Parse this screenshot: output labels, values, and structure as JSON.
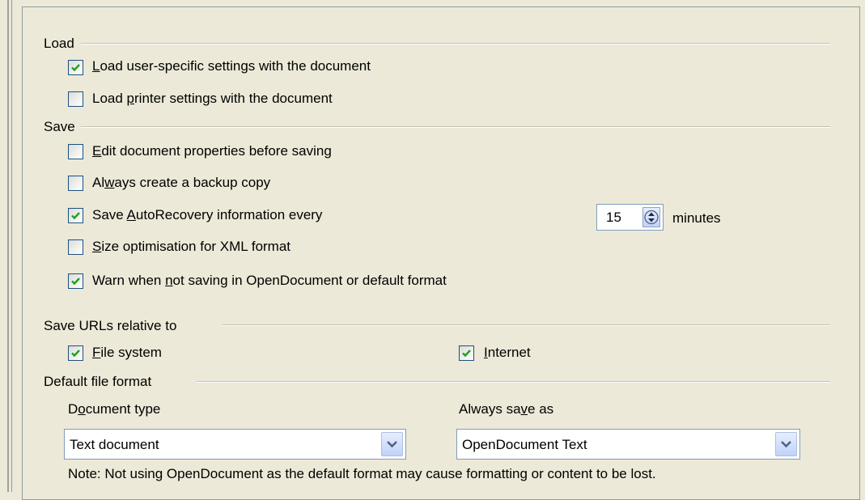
{
  "load": {
    "heading": "Load",
    "user_settings": {
      "pre": "",
      "mn": "L",
      "post": "oad user-specific settings with the document",
      "checked": true
    },
    "printer_settings": {
      "pre": "Load ",
      "mn": "p",
      "post": "rinter settings with the document",
      "checked": false
    }
  },
  "save": {
    "heading": "Save",
    "edit_props": {
      "pre": "",
      "mn": "E",
      "post": "dit document properties before saving",
      "checked": false
    },
    "backup": {
      "pre": "Al",
      "mn": "w",
      "post": "ays create a backup copy",
      "checked": false
    },
    "autorecovery": {
      "pre": "Save ",
      "mn": "A",
      "post": "utoRecovery information every",
      "checked": true
    },
    "autorecovery_minutes": "15",
    "minutes_label": "minutes",
    "size_opt": {
      "pre": "",
      "mn": "S",
      "post": "ize optimisation for XML format",
      "checked": false
    },
    "warn": {
      "pre": "Warn when ",
      "mn": "n",
      "post": "ot saving in OpenDocument or default format",
      "checked": true
    }
  },
  "urls": {
    "heading": "Save URLs relative to",
    "file_system": {
      "pre": "",
      "mn": "F",
      "post": "ile system",
      "checked": true
    },
    "internet": {
      "pre": "",
      "mn": "I",
      "post": "nternet",
      "checked": true
    }
  },
  "default_format": {
    "heading": "Default file format",
    "doc_type": {
      "pre": "D",
      "mn": "o",
      "post": "cument type"
    },
    "doc_type_value": "Text document",
    "always_save": {
      "pre": "Always sa",
      "mn": "v",
      "post": "e as"
    },
    "always_save_value": "OpenDocument Text",
    "note": "Note: Not using OpenDocument as the default format may cause formatting or content to be lost."
  }
}
